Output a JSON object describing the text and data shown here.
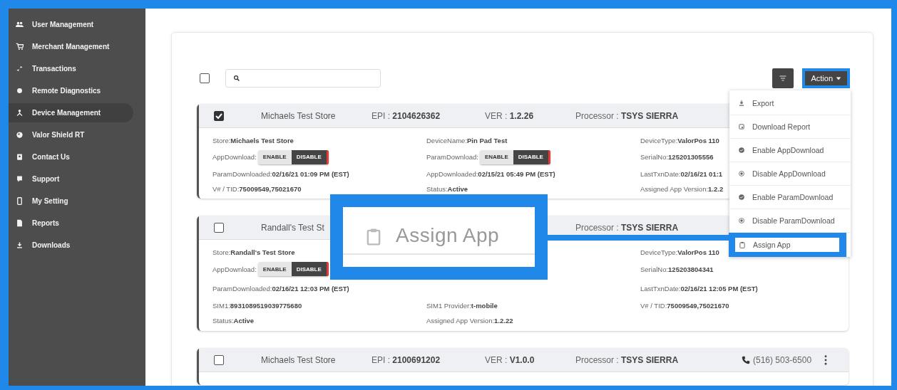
{
  "sidebar": {
    "items": [
      {
        "label": "User Management",
        "selected": false
      },
      {
        "label": "Merchant Management",
        "selected": false
      },
      {
        "label": "Transactions",
        "selected": false
      },
      {
        "label": "Remote Diagnostics",
        "selected": false
      },
      {
        "label": "Device Management",
        "selected": true
      },
      {
        "label": "Valor Shield RT",
        "selected": false
      },
      {
        "label": "Contact Us",
        "selected": false
      },
      {
        "label": "Support",
        "selected": false
      },
      {
        "label": "My Setting",
        "selected": false
      },
      {
        "label": "Reports",
        "selected": false
      },
      {
        "label": "Downloads",
        "selected": false
      }
    ]
  },
  "toolbar": {
    "select_all": {
      "checked": false
    },
    "action": {
      "label": "Action",
      "highlighted": true
    }
  },
  "action_menu": [
    {
      "label": "Export",
      "highlighted": false
    },
    {
      "label": "Download Report",
      "highlighted": false
    },
    {
      "label": "Enable AppDownload",
      "highlighted": false
    },
    {
      "label": "Disable AppDownload",
      "highlighted": false
    },
    {
      "label": "Enable ParamDownload",
      "highlighted": false
    },
    {
      "label": "Disable ParamDownload",
      "highlighted": false
    },
    {
      "label": "Assign App",
      "highlighted": true
    }
  ],
  "callout": {
    "label": "Assign App"
  },
  "cards": [
    {
      "checked": true,
      "header": {
        "title": "Michaels Test Store",
        "epi": {
          "label": "EPI : ",
          "value": "2104626362"
        },
        "ver": {
          "label": "VER : ",
          "value": "1.2.26"
        },
        "processor": {
          "label": "Processor : ",
          "value": "TSYS SIERRA"
        }
      },
      "columns": [
        [
          {
            "kind": "text",
            "label": "Store:",
            "value": "Michaels Test Store"
          },
          {
            "kind": "toggle",
            "label": "AppDownload:",
            "options": [
              {
                "label": "ENABLE",
                "selected": false
              },
              {
                "label": "DISABLE",
                "selected": true
              }
            ]
          },
          {
            "kind": "text",
            "label": "ParamDownloaded:",
            "value": "02/16/21 01:09 PM (EST)"
          },
          {
            "kind": "text",
            "label": "V# / TID:",
            "value": "75009549,75021670"
          }
        ],
        [
          {
            "kind": "text",
            "label": "DeviceName:",
            "value": "Pin Pad Test"
          },
          {
            "kind": "toggle",
            "label": "ParamDownload:",
            "options": [
              {
                "label": "ENABLE",
                "selected": false
              },
              {
                "label": "DISABLE",
                "selected": true
              }
            ]
          },
          {
            "kind": "text",
            "label": "AppDownloaded:",
            "value": "02/15/21 05:49 PM (EST)"
          },
          {
            "kind": "text",
            "label": "Status:",
            "value": "Active"
          }
        ],
        [
          {
            "kind": "text",
            "label": "DeviceType:",
            "value": "ValorPos 110"
          },
          {
            "kind": "text",
            "label": "SerialNo:",
            "value": "125201305556"
          },
          {
            "kind": "text",
            "label": "LastTxnDate:",
            "value": "02/16/21 01:1"
          },
          {
            "kind": "text",
            "label": "Assigned App Version:",
            "value": "1.2.2"
          }
        ]
      ]
    },
    {
      "checked": false,
      "header": {
        "title": "Randall's Test St",
        "processor": {
          "label": "Processor : ",
          "value": "TSYS SIERRA"
        }
      },
      "columns": [
        [
          {
            "kind": "text",
            "label": "Store:",
            "value": "Randall's Test Store"
          },
          {
            "kind": "toggle",
            "label": "AppDownload:",
            "options": [
              {
                "label": "ENABLE",
                "selected": false
              },
              {
                "label": "DISABLE",
                "selected": true
              }
            ]
          },
          {
            "kind": "text",
            "label": "ParamDownloaded:",
            "value": "02/16/21 12:03 PM (EST)"
          },
          {
            "kind": "text",
            "label": "SIM1:",
            "value": "8931089519039775680"
          },
          {
            "kind": "text",
            "label": "Status:",
            "value": "Active"
          }
        ],
        [
          {
            "kind": "text",
            "label": "SIM1 Provider:",
            "value": "t-mobile"
          },
          {
            "kind": "text",
            "label": "Assigned App Version:",
            "value": "1.2.22"
          }
        ],
        [
          {
            "kind": "text",
            "label": "DeviceType:",
            "value": "ValorPos 110"
          },
          {
            "kind": "text",
            "label": "SerialNo:",
            "value": "125203804341"
          },
          {
            "kind": "text",
            "label": "LastTxnDate:",
            "value": "02/16/21 12:05 PM (EST)"
          },
          {
            "kind": "text",
            "label": "V# / TID:",
            "value": "75009549,75021670"
          }
        ]
      ]
    },
    {
      "checked": false,
      "header": {
        "title": "Michaels Test Store",
        "epi": {
          "label": "EPI : ",
          "value": "2100691202"
        },
        "ver": {
          "label": "VER : ",
          "value": "V1.0.0"
        },
        "processor": {
          "label": "Processor : ",
          "value": "TSYS SIERRA"
        },
        "phone": "(516) 503-6500"
      }
    }
  ]
}
